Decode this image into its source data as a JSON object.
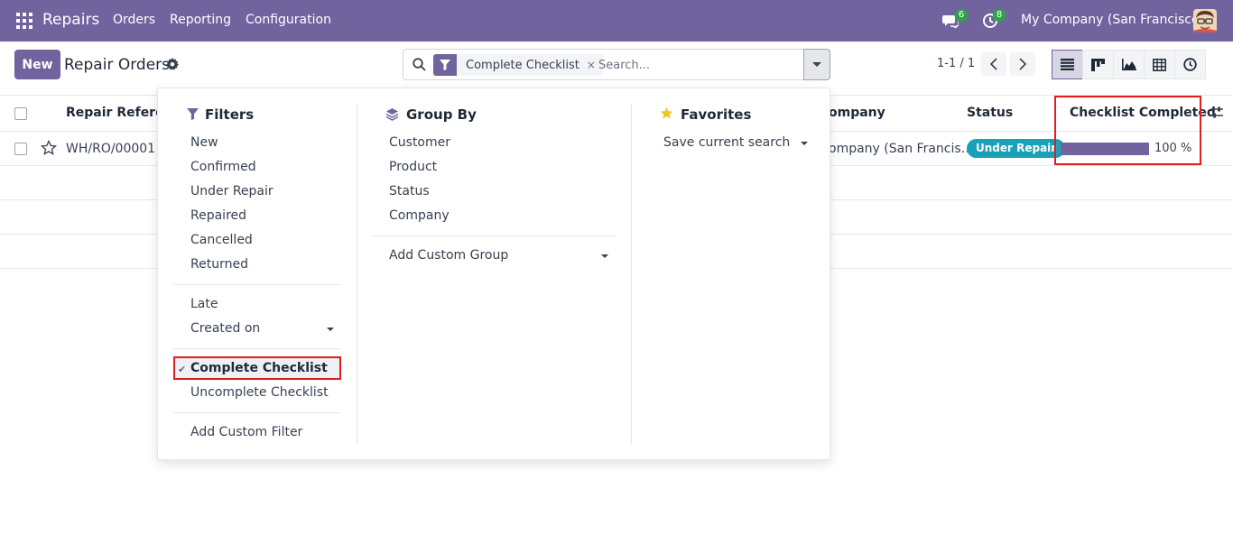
{
  "navbar": {
    "app_name": "Repairs",
    "menus": [
      "Orders",
      "Reporting",
      "Configuration"
    ],
    "messages_count": "6",
    "activities_count": "8",
    "company": "My Company (San Francisco)"
  },
  "control": {
    "new_label": "New",
    "title": "Repair Orders",
    "facet_label": "Complete Checklist",
    "facet_close": "×",
    "search_placeholder": "Search...",
    "pager": "1-1 / 1"
  },
  "list": {
    "headers": [
      "Repair Reference",
      "ompany",
      "Status",
      "Checklist Completed"
    ],
    "rows": [
      {
        "reference": "WH/RO/00001",
        "company": "ompany (San Francis…",
        "status": "Under Repair",
        "progress": 100,
        "progress_label": "100 %"
      }
    ]
  },
  "dropdown": {
    "filters": {
      "title": "Filters",
      "group1": [
        "New",
        "Confirmed",
        "Under Repair",
        "Repaired",
        "Cancelled",
        "Returned"
      ],
      "group2": [
        "Late",
        "Created on"
      ],
      "group3": [
        "Complete Checklist",
        "Uncomplete Checklist"
      ],
      "custom": "Add Custom Filter",
      "checkmark": "✔"
    },
    "groupby": {
      "title": "Group By",
      "items": [
        "Customer",
        "Product",
        "Status",
        "Company"
      ],
      "custom": "Add Custom Group"
    },
    "favorites": {
      "title": "Favorites",
      "save": "Save current search"
    }
  },
  "colors": {
    "brand": "#71639e",
    "status_info": "#17a2b8",
    "highlight": "#e11d1d",
    "badge_green": "#28a745"
  }
}
